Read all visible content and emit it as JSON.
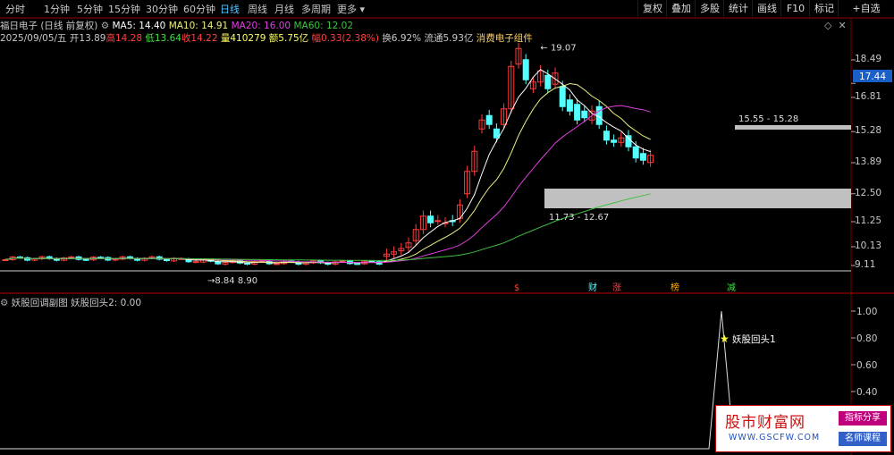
{
  "toolbar": {
    "timeframes": [
      "分时",
      "1分钟",
      "5分钟",
      "15分钟",
      "30分钟",
      "60分钟",
      "日线",
      "周线",
      "月线",
      "多周期",
      "更多"
    ],
    "active": "日线",
    "buttons": [
      "复权",
      "叠加",
      "多股",
      "统计",
      "画线",
      "F10",
      "标记",
      "+自选"
    ]
  },
  "stock": {
    "title": "福日电子 (日线 前复权)",
    "ma5": "MA5: 14.40",
    "ma10": "MA10: 14.91",
    "ma20": "MA20: 16.00",
    "ma60": "MA60: 12.02",
    "date": "2025/09/05/五",
    "open": "开13.89",
    "high": "高14.28",
    "low": "低13.64",
    "close": "收14.22",
    "volume": "量410279",
    "amount": "额5.75亿",
    "change": "幅0.33(2.38%)",
    "turnover": "换6.92%",
    "float": "流通5.93亿",
    "sector": "消费电子组件"
  },
  "colors": {
    "up": "#ff3c3c",
    "down": "#54ffff",
    "ma5": "#ffffff",
    "ma10": "#f0f080",
    "ma20": "#e040e0",
    "ma60": "#40c040",
    "grid": "#7a0000",
    "zone": "#c0c0c0"
  },
  "price_axis": {
    "labels": [
      "18.49",
      "17.44",
      "16.81",
      "15.28",
      "13.89",
      "12.50",
      "11.25",
      "10.13",
      "9.11"
    ],
    "current": "17.44"
  },
  "annotations": {
    "high": "19.07",
    "low": "8.90",
    "low_mark": "8.84",
    "zone_upper": "15.55 - 15.28",
    "zone_lower": "11.73 - 12.67"
  },
  "event_markers": [
    {
      "label": "$",
      "color": "#ff4040"
    },
    {
      "label": "财",
      "color": "#54ffff"
    },
    {
      "label": "涨",
      "color": "#ff4040"
    },
    {
      "label": "榜",
      "color": "#ffb000"
    },
    {
      "label": "减",
      "color": "#40e040"
    }
  ],
  "subchart": {
    "title": "妖股回调副图",
    "value": "妖股回头2: 0.00",
    "signal_label": "妖股回头1",
    "axis": [
      "1.00",
      "0.80",
      "0.60",
      "0.40"
    ]
  },
  "watermark": {
    "title": "股市财富网",
    "url": "WWW.GSCFW.COM",
    "btn1": "指标分享",
    "btn2": "名师课程"
  }
}
